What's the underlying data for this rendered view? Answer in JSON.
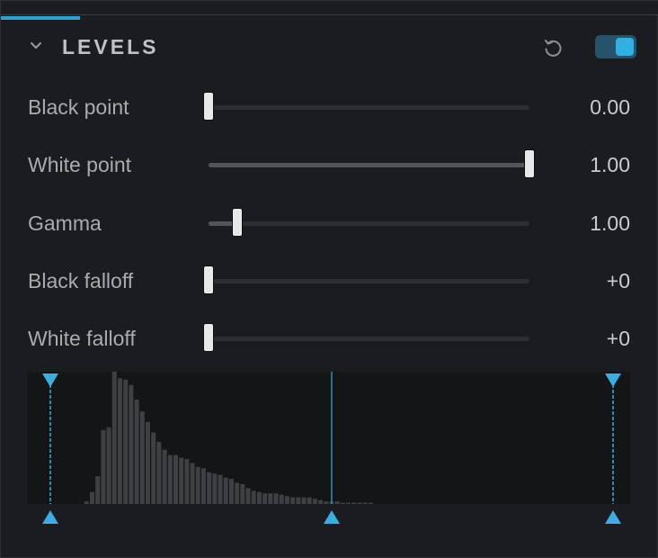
{
  "panel": {
    "title": "LEVELS",
    "enabled": true,
    "accent_color": "#2ba3d3",
    "icons": {
      "collapse": "chevron-down-icon",
      "reset": "reset-icon"
    }
  },
  "sliders": [
    {
      "id": "black-point",
      "label": "Black point",
      "value": "0.00",
      "position": 0.0,
      "fill": false
    },
    {
      "id": "white-point",
      "label": "White point",
      "value": "1.00",
      "position": 1.0,
      "fill": true
    },
    {
      "id": "gamma",
      "label": "Gamma",
      "value": "1.00",
      "position": 0.09,
      "fill": true
    },
    {
      "id": "black-falloff",
      "label": "Black falloff",
      "value": "+0",
      "position": 0.0,
      "fill": false
    },
    {
      "id": "white-falloff",
      "label": "White falloff",
      "value": "+0",
      "position": 0.0,
      "fill": false
    }
  ],
  "histogram": {
    "bins": [
      0,
      0,
      0,
      0,
      0,
      0,
      2,
      9,
      21,
      56,
      58,
      100,
      95,
      94,
      90,
      79,
      70,
      62,
      54,
      47,
      41,
      37,
      37,
      35,
      34,
      31,
      28,
      27,
      24,
      23,
      22,
      20,
      19,
      16,
      15,
      12,
      10,
      9,
      8,
      8,
      8,
      7,
      6,
      5,
      5,
      5,
      5,
      4,
      3,
      2,
      2,
      2,
      1,
      1,
      1,
      1,
      1,
      1,
      0,
      0,
      0,
      0,
      0,
      0,
      0,
      0,
      0,
      0,
      0,
      0,
      0,
      0,
      0,
      0,
      0,
      0,
      0,
      0,
      0,
      0,
      0,
      0,
      0,
      0,
      0,
      0,
      0,
      0,
      0,
      0,
      0,
      0,
      0,
      0,
      0,
      0,
      0,
      0,
      0,
      0,
      0
    ],
    "markers": {
      "black": 0.0,
      "gray": 0.5,
      "white": 1.0
    }
  }
}
